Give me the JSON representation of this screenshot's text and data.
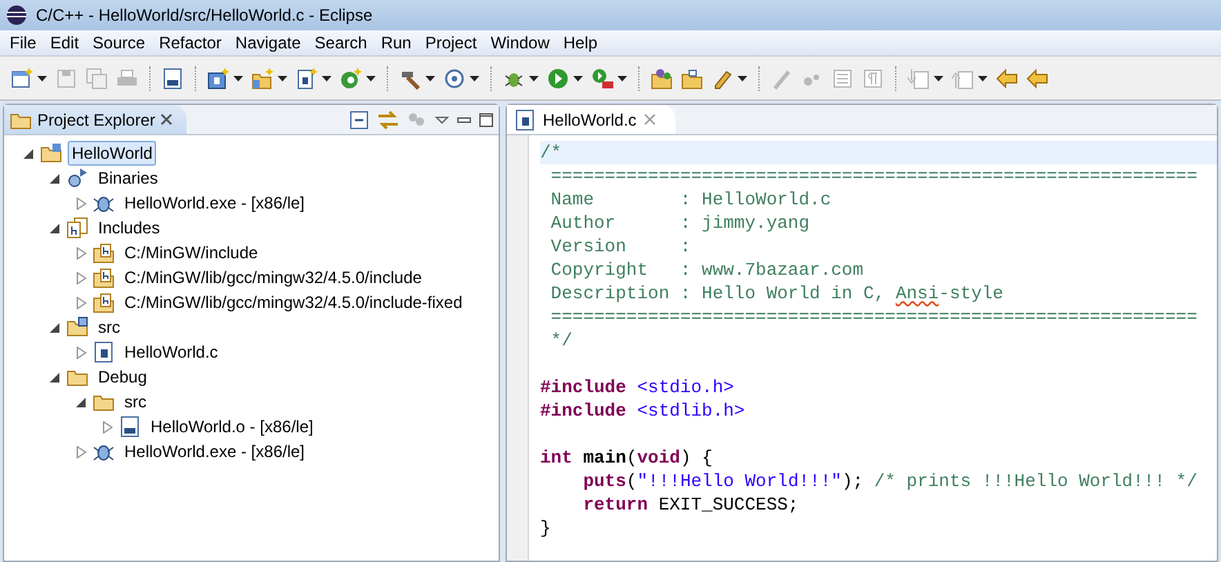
{
  "window": {
    "title": "C/C++ - HelloWorld/src/HelloWorld.c - Eclipse"
  },
  "menu": [
    "File",
    "Edit",
    "Source",
    "Refactor",
    "Navigate",
    "Search",
    "Run",
    "Project",
    "Window",
    "Help"
  ],
  "toolbar": [
    {
      "items": [
        {
          "kind": "new",
          "disabled": false,
          "dropdown": true
        },
        {
          "kind": "save",
          "disabled": true,
          "dropdown": false
        },
        {
          "kind": "save_all",
          "disabled": true,
          "dropdown": false
        },
        {
          "kind": "print",
          "disabled": true,
          "dropdown": false
        }
      ]
    },
    {
      "items": [
        {
          "kind": "binary",
          "disabled": false,
          "dropdown": false
        }
      ]
    },
    {
      "items": [
        {
          "kind": "c_project",
          "disabled": false,
          "dropdown": true
        },
        {
          "kind": "c_folder",
          "disabled": false,
          "dropdown": true
        },
        {
          "kind": "c_file",
          "disabled": false,
          "dropdown": true
        },
        {
          "kind": "class",
          "disabled": false,
          "dropdown": true
        }
      ]
    },
    {
      "items": [
        {
          "kind": "hammer",
          "disabled": false,
          "dropdown": true
        },
        {
          "kind": "target",
          "disabled": false,
          "dropdown": true
        }
      ]
    },
    {
      "items": [
        {
          "kind": "bug",
          "disabled": false,
          "dropdown": true
        },
        {
          "kind": "run",
          "disabled": false,
          "dropdown": true
        },
        {
          "kind": "run_ext",
          "disabled": false,
          "dropdown": true
        }
      ]
    },
    {
      "items": [
        {
          "kind": "open_type",
          "disabled": false,
          "dropdown": false
        },
        {
          "kind": "open_folder",
          "disabled": false,
          "dropdown": false
        },
        {
          "kind": "pen",
          "disabled": false,
          "dropdown": true
        }
      ]
    },
    {
      "items": [
        {
          "kind": "marker",
          "disabled": true,
          "dropdown": false
        },
        {
          "kind": "dots",
          "disabled": true,
          "dropdown": false
        },
        {
          "kind": "block",
          "disabled": true,
          "dropdown": false
        },
        {
          "kind": "pilcrow",
          "disabled": true,
          "dropdown": false
        }
      ]
    },
    {
      "items": [
        {
          "kind": "down",
          "disabled": true,
          "dropdown": true
        },
        {
          "kind": "up",
          "disabled": true,
          "dropdown": true
        },
        {
          "kind": "back_edit",
          "disabled": false,
          "dropdown": false
        },
        {
          "kind": "back",
          "disabled": false,
          "dropdown": false
        }
      ]
    }
  ],
  "explorer": {
    "title": "Project Explorer",
    "tree": [
      {
        "label": "HelloWorld",
        "kind": "project",
        "expanded": true,
        "selected": true,
        "children": [
          {
            "label": "Binaries",
            "kind": "binaries",
            "expanded": true,
            "selected": false,
            "children": [
              {
                "label": "HelloWorld.exe - [x86/le]",
                "kind": "exe",
                "expanded": false,
                "selected": false
              }
            ]
          },
          {
            "label": "Includes",
            "kind": "includes",
            "expanded": true,
            "selected": false,
            "children": [
              {
                "label": "C:/MinGW/include",
                "kind": "include_dir",
                "expanded": false,
                "selected": false
              },
              {
                "label": "C:/MinGW/lib/gcc/mingw32/4.5.0/include",
                "kind": "include_dir",
                "expanded": false,
                "selected": false
              },
              {
                "label": "C:/MinGW/lib/gcc/mingw32/4.5.0/include-fixed",
                "kind": "include_dir",
                "expanded": false,
                "selected": false
              }
            ]
          },
          {
            "label": "src",
            "kind": "src_folder",
            "expanded": true,
            "selected": false,
            "children": [
              {
                "label": "HelloWorld.c",
                "kind": "c_file",
                "expanded": false,
                "selected": false
              }
            ]
          },
          {
            "label": "Debug",
            "kind": "folder",
            "expanded": true,
            "selected": false,
            "children": [
              {
                "label": "src",
                "kind": "folder",
                "expanded": true,
                "selected": false,
                "children": [
                  {
                    "label": "HelloWorld.o - [x86/le]",
                    "kind": "obj_file",
                    "expanded": false,
                    "selected": false
                  }
                ]
              },
              {
                "label": "HelloWorld.exe - [x86/le]",
                "kind": "exe",
                "expanded": false,
                "selected": false
              }
            ]
          }
        ]
      }
    ]
  },
  "editor": {
    "tab": "HelloWorld.c",
    "lines": [
      {
        "current": true,
        "tokens": [
          {
            "kind": "comment",
            "text": "/*"
          }
        ]
      },
      {
        "current": false,
        "tokens": [
          {
            "kind": "comment",
            "text": " ============================================================"
          }
        ]
      },
      {
        "current": false,
        "tokens": [
          {
            "kind": "comment",
            "text": " Name        : HelloWorld.c"
          }
        ]
      },
      {
        "current": false,
        "tokens": [
          {
            "kind": "comment",
            "text": " Author      : jimmy.yang"
          }
        ]
      },
      {
        "current": false,
        "tokens": [
          {
            "kind": "comment",
            "text": " Version     :"
          }
        ]
      },
      {
        "current": false,
        "tokens": [
          {
            "kind": "comment",
            "text": " Copyright   : www.7bazaar.com"
          }
        ]
      },
      {
        "current": false,
        "tokens": [
          {
            "kind": "comment",
            "text": " Description : Hello World in C, "
          },
          {
            "kind": "misspelled",
            "text": "Ansi"
          },
          {
            "kind": "comment",
            "text": "-style"
          }
        ]
      },
      {
        "current": false,
        "tokens": [
          {
            "kind": "comment",
            "text": " ============================================================"
          }
        ]
      },
      {
        "current": false,
        "tokens": [
          {
            "kind": "comment",
            "text": " */"
          }
        ]
      },
      {
        "current": false
      },
      {
        "current": false,
        "tokens": [
          {
            "kind": "directive",
            "text": "#include "
          },
          {
            "kind": "header",
            "text": "<stdio.h>"
          }
        ]
      },
      {
        "current": false,
        "tokens": [
          {
            "kind": "directive",
            "text": "#include "
          },
          {
            "kind": "header",
            "text": "<stdlib.h>"
          }
        ]
      },
      {
        "current": false
      },
      {
        "current": false,
        "tokens": [
          {
            "kind": "keyword",
            "text": "int "
          },
          {
            "kind": "function",
            "text": "main"
          },
          {
            "kind": "plain",
            "text": "("
          },
          {
            "kind": "keyword",
            "text": "void"
          },
          {
            "kind": "plain",
            "text": ") {"
          }
        ]
      },
      {
        "current": false,
        "indented": true,
        "tokens": [
          {
            "kind": "keyword",
            "text": "puts"
          },
          {
            "kind": "plain",
            "text": "("
          },
          {
            "kind": "string",
            "text": "\"!!!Hello World!!!\""
          },
          {
            "kind": "plain",
            "text": "); "
          },
          {
            "kind": "comment",
            "text": "/* prints !!!Hello World!!! */"
          }
        ]
      },
      {
        "current": false,
        "indented": true,
        "tokens": [
          {
            "kind": "keyword",
            "text": "return "
          },
          {
            "kind": "plain",
            "text": "EXIT_SUCCESS;"
          }
        ]
      },
      {
        "current": false,
        "tokens": [
          {
            "kind": "plain",
            "text": "}"
          }
        ]
      }
    ]
  }
}
